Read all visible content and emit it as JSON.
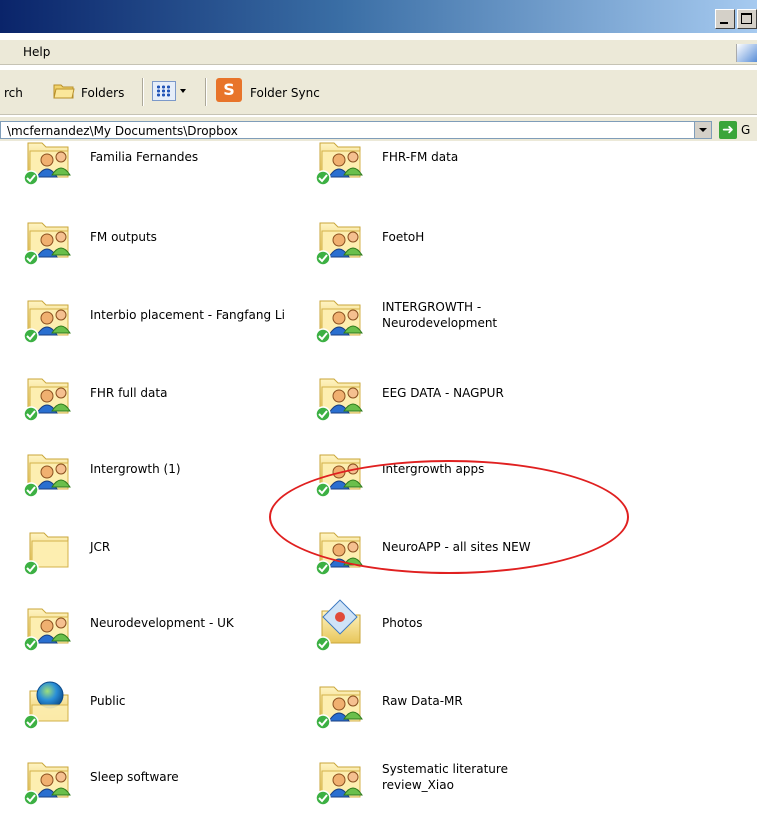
{
  "window": {
    "colors": {
      "title_start": "#0a246a",
      "title_end": "#a6caf0",
      "chrome": "#ece9d8"
    }
  },
  "menubar": {
    "items": [
      "Help"
    ]
  },
  "toolbar": {
    "search_label": "rch",
    "folders_label": "Folders",
    "sync_label": "Folder Sync"
  },
  "address": {
    "path": "\\mcfernandez\\My Documents\\Dropbox",
    "go_label": "G"
  },
  "folders": [
    {
      "name": "Familia Fernandes",
      "icon": "shared-folder-icon",
      "synced": true
    },
    {
      "name": "FHR-FM data",
      "icon": "shared-folder-icon",
      "synced": true
    },
    {
      "name": "FM outputs",
      "icon": "shared-folder-icon",
      "synced": true
    },
    {
      "name": "FoetoH",
      "icon": "shared-folder-icon",
      "synced": true
    },
    {
      "name": "Interbio placement - Fangfang Li",
      "icon": "shared-folder-icon",
      "synced": true
    },
    {
      "name": "INTERGROWTH -\nNeurodevelopment",
      "icon": "shared-folder-icon",
      "synced": true
    },
    {
      "name": "FHR full data",
      "icon": "shared-folder-icon",
      "synced": true
    },
    {
      "name": "EEG DATA - NAGPUR",
      "icon": "shared-folder-icon",
      "synced": true
    },
    {
      "name": "Intergrowth (1)",
      "icon": "shared-folder-icon",
      "synced": true
    },
    {
      "name": "Intergrowth apps",
      "icon": "shared-folder-icon",
      "synced": true
    },
    {
      "name": "JCR",
      "icon": "folder-icon",
      "synced": true
    },
    {
      "name": "NeuroAPP - all sites NEW",
      "icon": "shared-folder-icon",
      "synced": true
    },
    {
      "name": "Neurodevelopment - UK",
      "icon": "shared-folder-icon",
      "synced": true
    },
    {
      "name": "Photos",
      "icon": "photos-folder-icon",
      "synced": true
    },
    {
      "name": "Public",
      "icon": "public-folder-icon",
      "synced": true
    },
    {
      "name": "Raw Data-MR",
      "icon": "shared-folder-icon",
      "synced": true
    },
    {
      "name": "Sleep software",
      "icon": "shared-folder-icon",
      "synced": true
    },
    {
      "name": "Systematic literature\nreview_Xiao",
      "icon": "shared-folder-icon",
      "synced": true
    }
  ],
  "highlight": {
    "target": "EEG DATA - NAGPUR",
    "color": "#e02020"
  }
}
